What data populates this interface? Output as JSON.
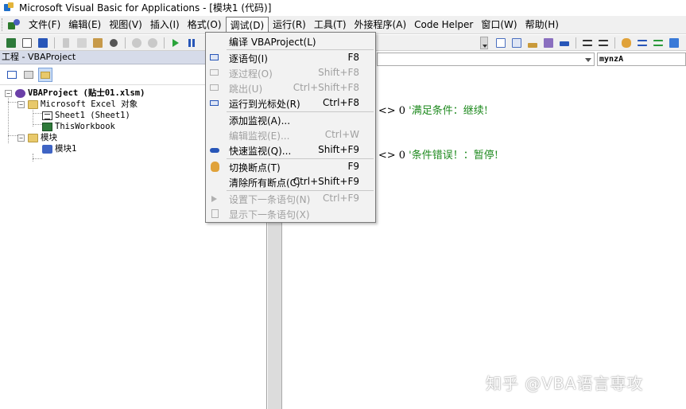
{
  "window": {
    "title": "Microsoft Visual Basic for Applications - [模块1 (代码)]"
  },
  "menubar": {
    "items": [
      "文件(F)",
      "编辑(E)",
      "视图(V)",
      "插入(I)",
      "格式(O)",
      "调试(D)",
      "运行(R)",
      "工具(T)",
      "外接程序(A)",
      "Code Helper",
      "窗口(W)",
      "帮助(H)"
    ],
    "active_index": 5
  },
  "project": {
    "title": "工程 - VBAProject",
    "tree": {
      "root": "VBAProject (贴士01.xlsm)",
      "excel_objects": "Microsoft Excel 对象",
      "sheet1": "Sheet1 (Sheet1)",
      "workbook": "ThisWorkbook",
      "modules": "模块",
      "module1": "模块1"
    }
  },
  "code": {
    "procedure_combo": "mynzA",
    "lines": [
      {
        "code": "t y <> 0 ",
        "comment": "'满足条件：继续!"
      },
      {
        "code": "t y <> 0 ",
        "comment": "'条件错误！：暂停!"
      }
    ]
  },
  "debug_menu": {
    "items": [
      {
        "icon": "compile-icon",
        "label": "编译 VBAProject(L)",
        "shortcut": "",
        "enabled": true
      },
      {
        "icon": "step-into-icon",
        "label": "逐语句(I)",
        "shortcut": "F8",
        "enabled": true
      },
      {
        "icon": "step-over-icon",
        "label": "逐过程(O)",
        "shortcut": "Shift+F8",
        "enabled": false
      },
      {
        "icon": "step-out-icon",
        "label": "跳出(U)",
        "shortcut": "Ctrl+Shift+F8",
        "enabled": false
      },
      {
        "icon": "run-to-cursor-icon",
        "label": "运行到光标处(R)",
        "shortcut": "Ctrl+F8",
        "enabled": true
      },
      {
        "icon": "",
        "label": "添加监视(A)...",
        "shortcut": "",
        "enabled": true
      },
      {
        "icon": "",
        "label": "编辑监视(E)...",
        "shortcut": "Ctrl+W",
        "enabled": false
      },
      {
        "icon": "quick-watch-icon",
        "label": "快速监视(Q)...",
        "shortcut": "Shift+F9",
        "enabled": true
      },
      {
        "icon": "breakpoint-hand-icon",
        "label": "切换断点(T)",
        "shortcut": "F9",
        "enabled": true
      },
      {
        "icon": "",
        "label": "清除所有断点(C)",
        "shortcut": "Ctrl+Shift+F9",
        "enabled": true
      },
      {
        "icon": "set-next-statement-icon",
        "label": "设置下一条语句(N)",
        "shortcut": "Ctrl+F9",
        "enabled": false
      },
      {
        "icon": "show-next-statement-icon",
        "label": "显示下一条语句(X)",
        "shortcut": "",
        "enabled": false
      }
    ]
  },
  "watermark": "知乎 @VBA语言専攻"
}
